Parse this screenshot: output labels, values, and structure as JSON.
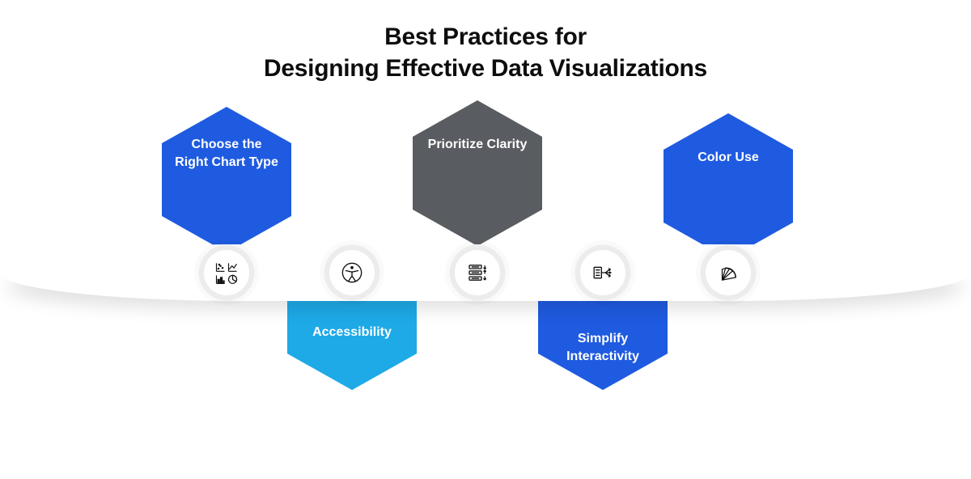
{
  "title_line1": "Best Practices for",
  "title_line2": "Designing Effective Data Visualizations",
  "items": [
    {
      "label": "Choose the Right Chart Type",
      "color": "#1f5be0",
      "position": "top",
      "icon": "charts-icon"
    },
    {
      "label": "Accessibility",
      "color": "#1ea9e7",
      "position": "bottom",
      "icon": "accessibility-icon"
    },
    {
      "label": "Prioritize Clarity",
      "color": "#595c60",
      "position": "top",
      "icon": "clarity-icon"
    },
    {
      "label": "Simplify Interactivity",
      "color": "#1f5be0",
      "position": "bottom",
      "icon": "interactivity-icon"
    },
    {
      "label": "Color Use",
      "color": "#1f5be0",
      "position": "top",
      "icon": "palette-icon"
    }
  ]
}
